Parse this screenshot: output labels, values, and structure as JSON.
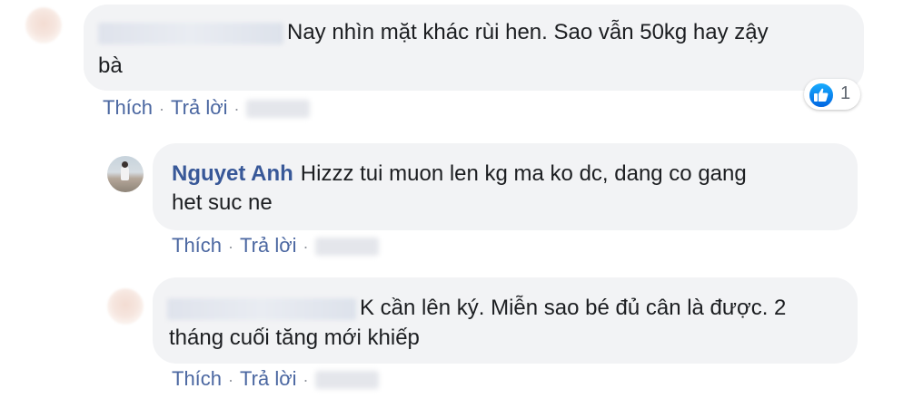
{
  "comments": [
    {
      "author": "",
      "text_line1": "Nay nhìn mặt khác rùi hen. Sao vẫn 50kg hay zậy",
      "text_line2": "bà",
      "actions": {
        "like": "Thích",
        "reply": "Trả lời"
      },
      "reaction": {
        "icon": "like-icon",
        "count": "1"
      }
    },
    {
      "author": "Nguyet Anh",
      "text_line1": "Hizzz tui muon len kg ma ko dc, dang co gang",
      "text_line2": "het suc ne",
      "actions": {
        "like": "Thích",
        "reply": "Trả lời"
      }
    },
    {
      "author": "",
      "text_line1": "K cần lên ký. Miễn sao bé đủ cân là được. 2",
      "text_line2": "tháng cuối tăng mới khiếp",
      "actions": {
        "like": "Thích",
        "reply": "Trả lời"
      }
    }
  ],
  "colors": {
    "bubble": "#f2f3f5",
    "link": "#4b67a1",
    "author": "#385898",
    "like_blue": "#1877f2"
  }
}
